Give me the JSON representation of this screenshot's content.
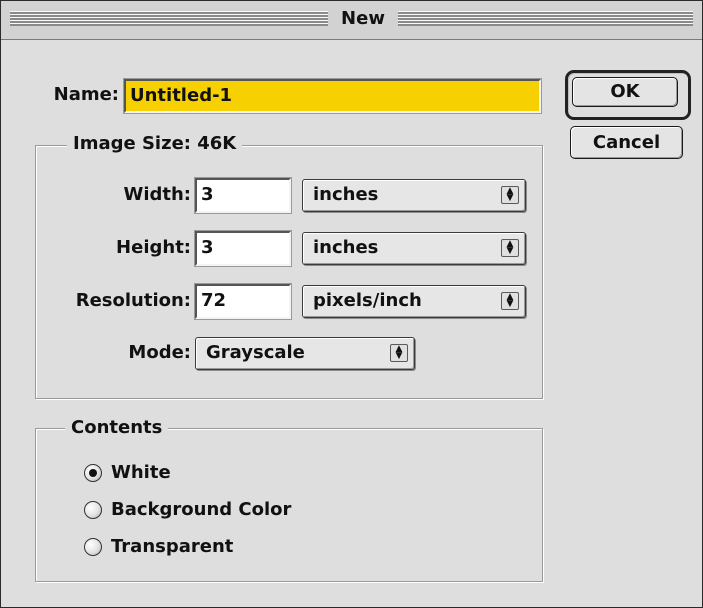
{
  "dialog": {
    "title": "New",
    "name_label": "Name:",
    "name_value": "Untitled-1",
    "ok_label": "OK",
    "cancel_label": "Cancel"
  },
  "image_size": {
    "legend": "Image Size: 46K",
    "width": {
      "label": "Width:",
      "value": "3",
      "unit": "inches"
    },
    "height": {
      "label": "Height:",
      "value": "3",
      "unit": "inches"
    },
    "resolution": {
      "label": "Resolution:",
      "value": "72",
      "unit": "pixels/inch"
    },
    "mode": {
      "label": "Mode:",
      "value": "Grayscale"
    }
  },
  "contents": {
    "legend": "Contents",
    "options": [
      {
        "label": "White",
        "selected": true
      },
      {
        "label": "Background Color",
        "selected": false
      },
      {
        "label": "Transparent",
        "selected": false
      }
    ]
  },
  "colors": {
    "name_highlight": "#f6d000",
    "dialog_bg": "#dedede"
  },
  "icons": {
    "popup_arrow": "updown-arrow-icon",
    "radio": "radio-button-icon"
  }
}
